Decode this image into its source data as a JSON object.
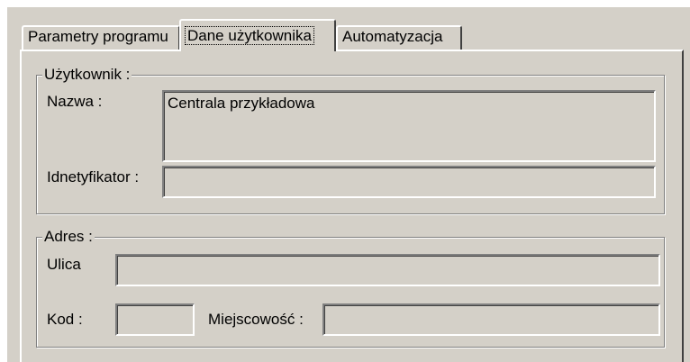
{
  "tabs": [
    {
      "label": "Parametry programu"
    },
    {
      "label": "Dane użytkownika"
    },
    {
      "label": "Automatyzacja"
    }
  ],
  "user_group": {
    "title": "Użytkownik :",
    "name_label": "Nazwa :",
    "name_value": "Centrala przykładowa",
    "id_label": "Idnetyfikator :",
    "id_value": ""
  },
  "address_group": {
    "title": "Adres :",
    "street_label": "Ulica",
    "street_value": "",
    "code_label": "Kod :",
    "code_value": "",
    "city_label": "Miejscowość :",
    "city_value": ""
  }
}
